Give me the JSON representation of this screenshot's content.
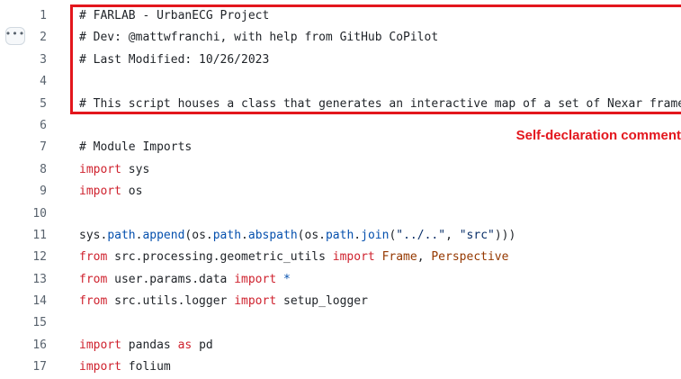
{
  "editor": {
    "more_options_label": "•••",
    "annotation": "Self-declaration comment",
    "highlight_color": "#e3161d",
    "lines": [
      {
        "n": "1",
        "tokens": [
          {
            "t": "# FARLAB - UrbanECG Project",
            "c": "cmt"
          }
        ]
      },
      {
        "n": "2",
        "tokens": [
          {
            "t": "# Dev: @mattwfranchi, with help from GitHub CoPilot",
            "c": "cmt"
          }
        ]
      },
      {
        "n": "3",
        "tokens": [
          {
            "t": "# Last Modified: 10/26/2023",
            "c": "cmt"
          }
        ]
      },
      {
        "n": "4",
        "tokens": []
      },
      {
        "n": "5",
        "tokens": [
          {
            "t": "# This script houses a class that generates an interactive map of a set of Nexar frames.",
            "c": "cmt"
          }
        ]
      },
      {
        "n": "6",
        "tokens": []
      },
      {
        "n": "7",
        "tokens": [
          {
            "t": "# Module Imports",
            "c": "cmt"
          }
        ]
      },
      {
        "n": "8",
        "tokens": [
          {
            "t": "import",
            "c": "kw"
          },
          {
            "t": " sys",
            "c": ""
          }
        ]
      },
      {
        "n": "9",
        "tokens": [
          {
            "t": "import",
            "c": "kw"
          },
          {
            "t": " os",
            "c": ""
          }
        ]
      },
      {
        "n": "10",
        "tokens": []
      },
      {
        "n": "11",
        "tokens": [
          {
            "t": "sys.",
            "c": ""
          },
          {
            "t": "path",
            "c": "fn"
          },
          {
            "t": ".",
            "c": ""
          },
          {
            "t": "append",
            "c": "fn"
          },
          {
            "t": "(os.",
            "c": ""
          },
          {
            "t": "path",
            "c": "fn"
          },
          {
            "t": ".",
            "c": ""
          },
          {
            "t": "abspath",
            "c": "fn"
          },
          {
            "t": "(os.",
            "c": ""
          },
          {
            "t": "path",
            "c": "fn"
          },
          {
            "t": ".",
            "c": ""
          },
          {
            "t": "join",
            "c": "fn"
          },
          {
            "t": "(",
            "c": ""
          },
          {
            "t": "\"../..\"",
            "c": "str"
          },
          {
            "t": ", ",
            "c": ""
          },
          {
            "t": "\"src\"",
            "c": "str"
          },
          {
            "t": ")))",
            "c": ""
          }
        ]
      },
      {
        "n": "12",
        "tokens": [
          {
            "t": "from",
            "c": "kw"
          },
          {
            "t": " src.processing.geometric_utils ",
            "c": ""
          },
          {
            "t": "import",
            "c": "kw"
          },
          {
            "t": " ",
            "c": ""
          },
          {
            "t": "Frame",
            "c": "cls"
          },
          {
            "t": ", ",
            "c": ""
          },
          {
            "t": "Perspective",
            "c": "cls"
          }
        ]
      },
      {
        "n": "13",
        "tokens": [
          {
            "t": "from",
            "c": "kw"
          },
          {
            "t": " user.params.data ",
            "c": ""
          },
          {
            "t": "import",
            "c": "kw"
          },
          {
            "t": " ",
            "c": ""
          },
          {
            "t": "*",
            "c": "op"
          }
        ]
      },
      {
        "n": "14",
        "tokens": [
          {
            "t": "from",
            "c": "kw"
          },
          {
            "t": " src.utils.logger ",
            "c": ""
          },
          {
            "t": "import",
            "c": "kw"
          },
          {
            "t": " setup_logger",
            "c": ""
          }
        ]
      },
      {
        "n": "15",
        "tokens": []
      },
      {
        "n": "16",
        "tokens": [
          {
            "t": "import",
            "c": "kw"
          },
          {
            "t": " pandas ",
            "c": ""
          },
          {
            "t": "as",
            "c": "kw"
          },
          {
            "t": " pd",
            "c": ""
          }
        ]
      },
      {
        "n": "17",
        "tokens": [
          {
            "t": "import",
            "c": "kw"
          },
          {
            "t": " folium",
            "c": ""
          }
        ]
      }
    ]
  }
}
